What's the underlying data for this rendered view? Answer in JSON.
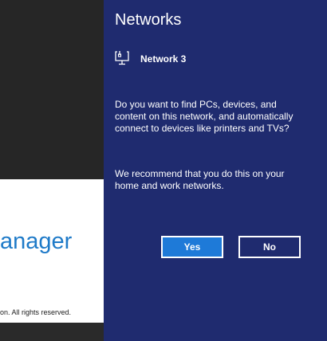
{
  "background": {
    "app_title": "anager",
    "copyright": "on. All rights reserved."
  },
  "pane": {
    "title": "Networks",
    "network": {
      "icon": "network-monitor-icon",
      "name": "Network 3"
    },
    "question": "Do you want to find PCs, devices, and content on this network, and automatically connect to devices like printers and TVs?",
    "recommendation": "We recommend that you do this on your home and work networks.",
    "buttons": {
      "yes": "Yes",
      "no": "No"
    }
  },
  "colors": {
    "pane_background": "#1f2b6f",
    "accent": "#1e7ad8"
  }
}
